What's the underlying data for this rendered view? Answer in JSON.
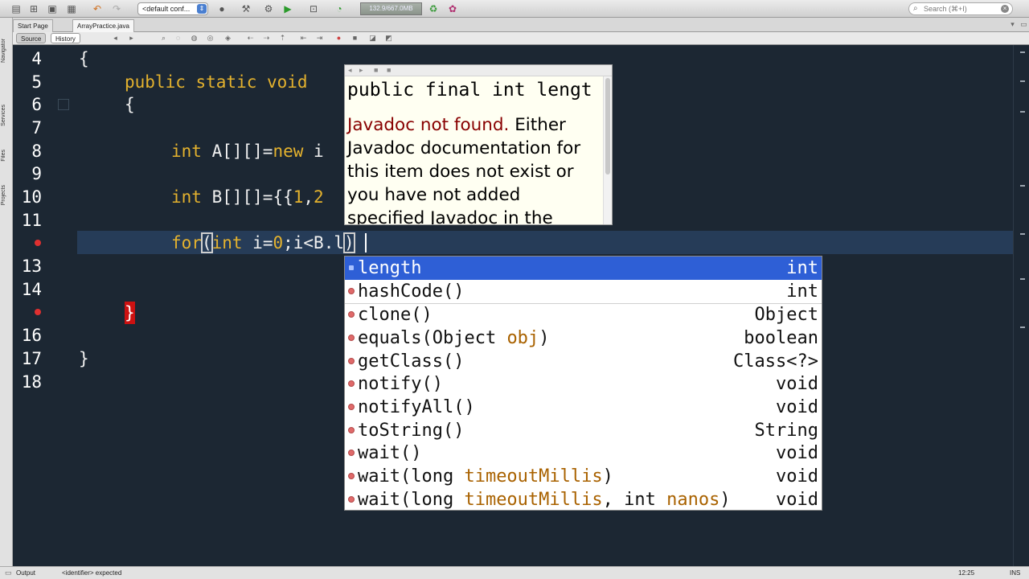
{
  "toolbar": {
    "config_label": "<default conf...",
    "memory_label": "132.9/667.0MB",
    "search_placeholder": "Search (⌘+I)"
  },
  "sidebar": {
    "items": [
      "Navigator",
      "Services",
      "Files",
      "Projects"
    ]
  },
  "tabs": [
    {
      "label": "Start Page"
    },
    {
      "label": "ArrayPractice.java"
    }
  ],
  "source_toolbar": {
    "source_label": "Source",
    "history_label": "History"
  },
  "editor": {
    "line_numbers": [
      "4",
      "5",
      "6",
      "7",
      "8",
      "9",
      "10",
      "11",
      "13",
      "14",
      "16",
      "17",
      "18"
    ],
    "lines": {
      "l4": "{",
      "l5_kw": "public static void",
      "l6": "{",
      "l8_kw": "int",
      "l8_a": " A[][]=",
      "l8_kw2": "new",
      "l8_b": " i",
      "l10_kw": "int",
      "l10_a": " B[][]={{",
      "l10_n1": "1",
      "l10_b": ",",
      "l10_n2": "2",
      "l12_kw": "for",
      "l12_p": "(",
      "l12_kw2": "int",
      "l12_a": " i=",
      "l12_n": "0",
      "l12_b": ";i<B.l",
      "l12_c": ")",
      "l15": "}",
      "l17": "}"
    }
  },
  "javadoc": {
    "signature": "public final int lengt",
    "not_found": "Javadoc not found.",
    "body": " Either Javadoc documentation for this item does not exist or you have not added specified Javadoc in the"
  },
  "completion": {
    "items": [
      {
        "name": "length",
        "type": "int"
      },
      {
        "name": "hashCode()",
        "type": "int"
      },
      {
        "name": "clone()",
        "type": "Object"
      },
      {
        "name_a": "equals(Object ",
        "param": "obj",
        "name_b": ")",
        "type": "boolean"
      },
      {
        "name": "getClass()",
        "type": "Class<?>"
      },
      {
        "name": "notify()",
        "type": "void"
      },
      {
        "name": "notifyAll()",
        "type": "void"
      },
      {
        "name": "toString()",
        "type": "String"
      },
      {
        "name": "wait()",
        "type": "void"
      },
      {
        "name_a": "wait(long ",
        "param": "timeoutMillis",
        "name_b": ")",
        "type": "void"
      },
      {
        "name_a": "wait(long ",
        "param": "timeoutMillis",
        "name_b": ", int ",
        "param2": "nanos",
        "name_c": ")",
        "type": "void"
      }
    ]
  },
  "status": {
    "output_label": "Output",
    "message": "<identifier> expected",
    "position": "12:25",
    "mode": "INS"
  },
  "colors": {
    "editor_bg": "#1c2733",
    "keyword": "#e4b22e",
    "selection": "#2e5fd6",
    "error": "#cc1111"
  }
}
